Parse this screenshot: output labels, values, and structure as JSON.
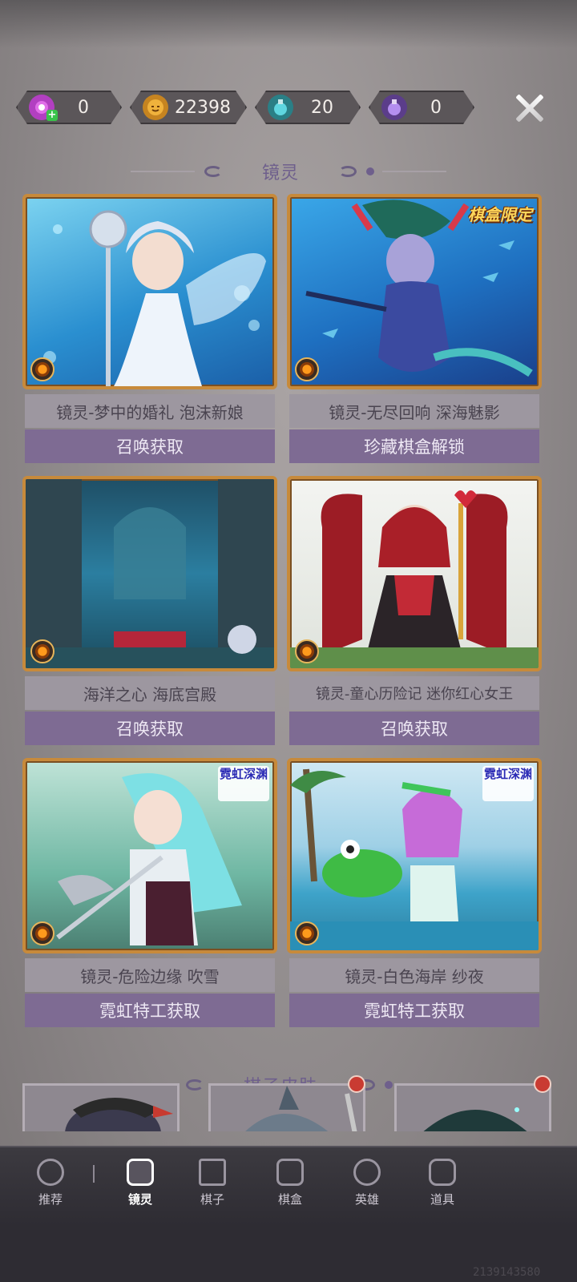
{
  "currencies": [
    {
      "icon": "candy-icon",
      "value": "0"
    },
    {
      "icon": "pumpkin-coin-icon",
      "value": "22398"
    },
    {
      "icon": "blue-potion-icon",
      "value": "20"
    },
    {
      "icon": "purple-potion-icon",
      "value": "0"
    }
  ],
  "sections": {
    "mirror_spirit": "镜灵",
    "chess_skin": "棋子皮肤"
  },
  "cards": [
    {
      "name": "镜灵-梦中的婚礼 泡沫新娘",
      "action": "召唤获取",
      "tag": ""
    },
    {
      "name": "镜灵-无尽回响 深海魅影",
      "action": "珍藏棋盒解锁",
      "tag": "棋盒限定"
    },
    {
      "name": "海洋之心 海底宫殿",
      "action": "召唤获取",
      "tag": ""
    },
    {
      "name": "镜灵-童心历险记 迷你红心女王",
      "action": "召唤获取",
      "tag": ""
    },
    {
      "name": "镜灵-危险边缘 吹雪",
      "action": "霓虹特工获取",
      "tag": "霓虹深渊"
    },
    {
      "name": "镜灵-白色海岸 纱夜",
      "action": "霓虹特工获取",
      "tag": "霓虹深渊"
    }
  ],
  "nav": [
    {
      "label": "推荐",
      "icon": "recommend-icon"
    },
    {
      "label": "镜灵",
      "icon": "mirror-spirit-icon",
      "active": true
    },
    {
      "label": "棋子",
      "icon": "chess-piece-icon"
    },
    {
      "label": "棋盒",
      "icon": "chess-box-icon"
    },
    {
      "label": "英雄",
      "icon": "hero-icon"
    },
    {
      "label": "道具",
      "icon": "item-icon"
    }
  ],
  "watermark": "2139143580"
}
